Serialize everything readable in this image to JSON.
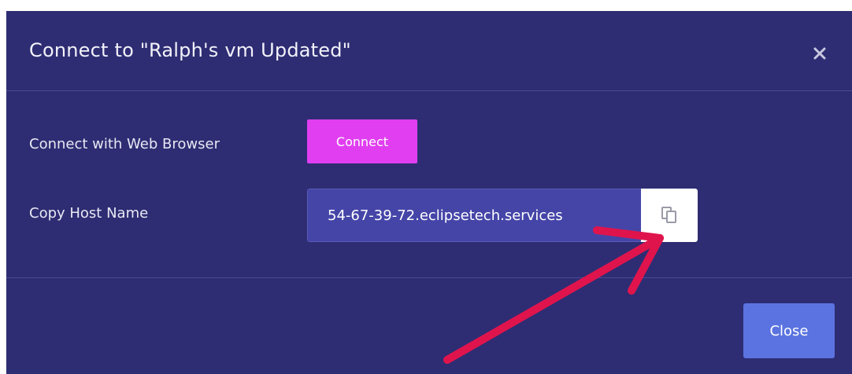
{
  "dialog": {
    "title": "Connect to \"Ralph's vm Updated\"",
    "close_icon": "close-x-icon"
  },
  "rows": {
    "web_browser_label": "Connect with Web Browser",
    "connect_button_label": "Connect",
    "host_label": "Copy Host Name",
    "host_value": "54-67-39-72.eclipsetech.services",
    "copy_icon": "copy-icon"
  },
  "footer": {
    "close_button_label": "Close"
  },
  "annotation": {
    "icon": "arrow-annotation",
    "color": "#e0144c"
  },
  "colors": {
    "modal_bg": "#2e2d73",
    "connect_button": "#e03ef0",
    "input_bg": "#4545a8",
    "close_button": "#5a73e0"
  }
}
